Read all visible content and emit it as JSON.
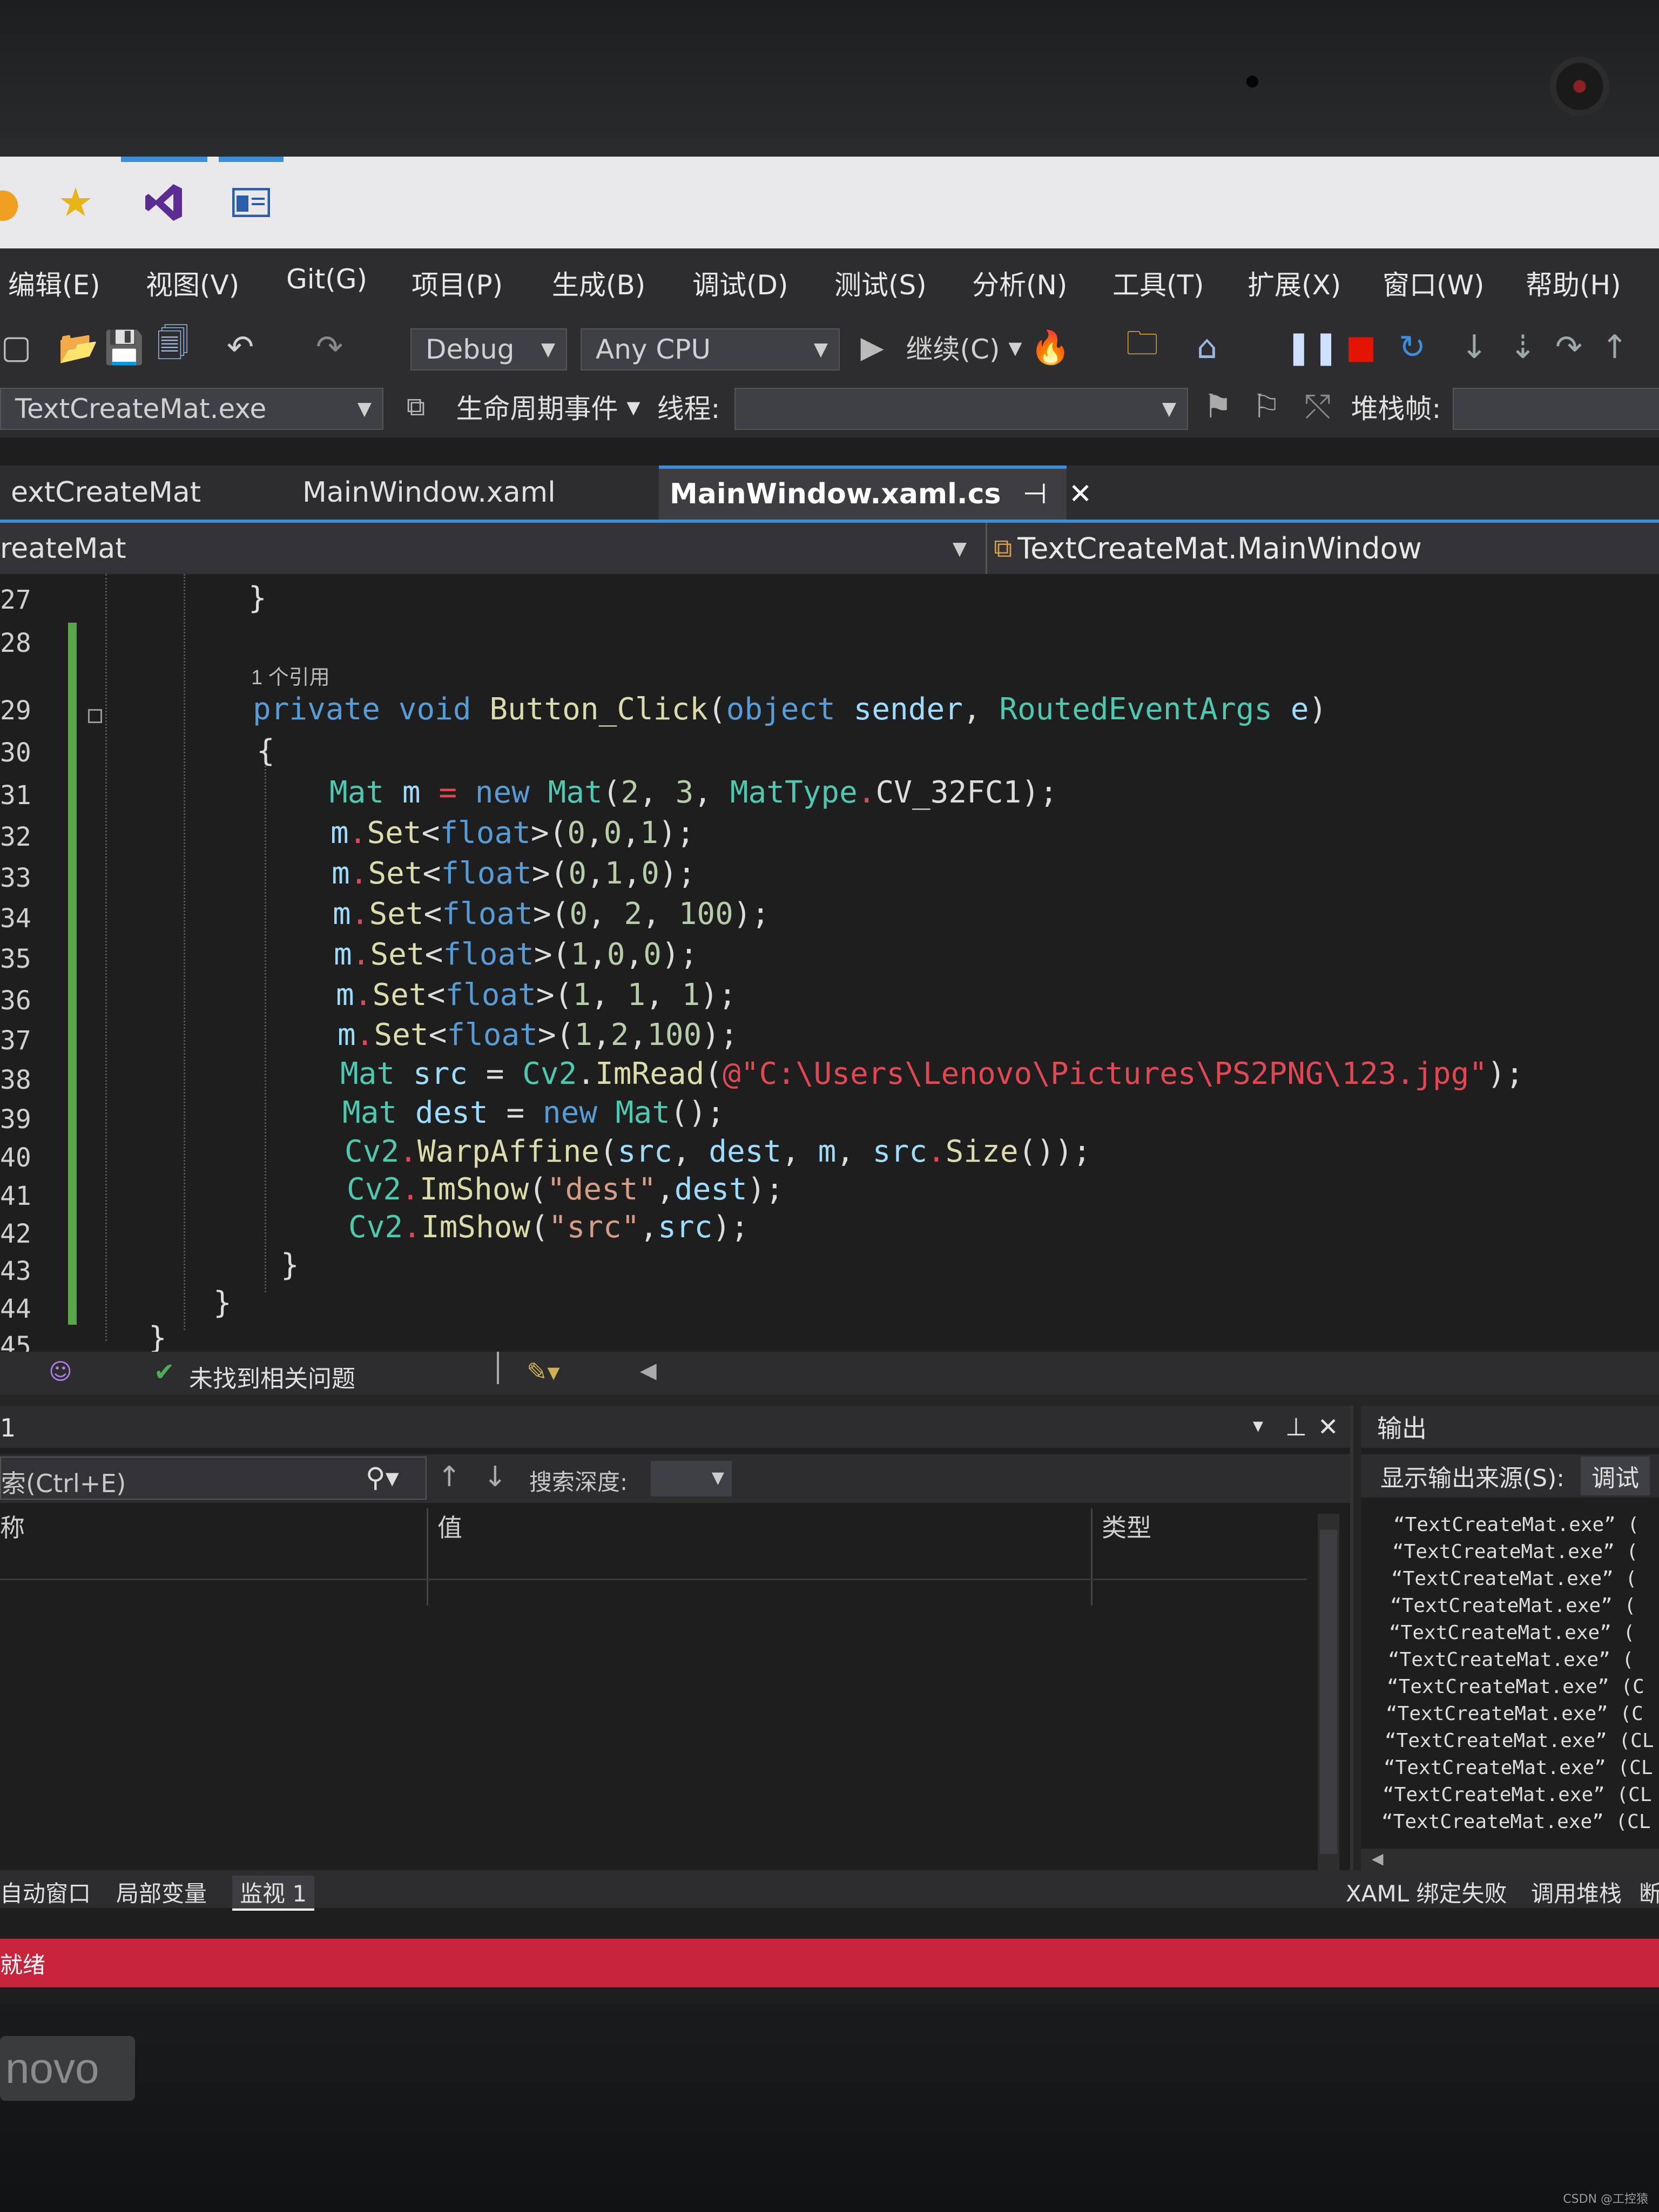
{
  "taskbar": {
    "icons": [
      "star-icon",
      "visual-studio-icon",
      "window-icon"
    ]
  },
  "menu": {
    "items": [
      "编辑(E)",
      "视图(V)",
      "Git(G)",
      "项目(P)",
      "生成(B)",
      "调试(D)",
      "测试(S)",
      "分析(N)",
      "工具(T)",
      "扩展(X)",
      "窗口(W)",
      "帮助(H)"
    ]
  },
  "toolbar": {
    "config": "Debug",
    "platform": "Any CPU",
    "continue": "继续(C)"
  },
  "toolbar2": {
    "process": "TextCreateMat.exe",
    "lifecycle": "生命周期事件",
    "thread": "线程:",
    "stackframe": "堆栈帧:"
  },
  "tabs": [
    "extCreateMat",
    "MainWindow.xaml",
    "MainWindow.xaml.cs"
  ],
  "navbar": {
    "left": "reateMat",
    "right": "TextCreateMat.MainWindow"
  },
  "editor": {
    "line_numbers": [
      "27",
      "28",
      "29",
      "30",
      "31",
      "32",
      "33",
      "34",
      "35",
      "36",
      "37",
      "38",
      "39",
      "40",
      "41",
      "42",
      "43",
      "44",
      "45"
    ],
    "ref_hint": "1 个引用"
  },
  "status": {
    "issues": "未找到相关问题"
  },
  "watch": {
    "title": "1",
    "search": "索(Ctrl+E)",
    "search_depth": "搜索深度:",
    "col_name": "称",
    "col_value": "值",
    "col_type": "类型",
    "tabs": [
      "自动窗口",
      "局部变量",
      "监视 1"
    ]
  },
  "output": {
    "title": "输出",
    "source_label": "显示输出来源(S):",
    "source_value": "调试",
    "lines": [
      "“TextCreateMat.exe” (",
      "“TextCreateMat.exe” (",
      "“TextCreateMat.exe” (",
      "“TextCreateMat.exe” (",
      "“TextCreateMat.exe” (",
      "“TextCreateMat.exe” (",
      "“TextCreateMat.exe” (C",
      "“TextCreateMat.exe” (C",
      "“TextCreateMat.exe” (CL",
      "“TextCreateMat.exe” (CL",
      "“TextCreateMat.exe” (CL",
      "“TextCreateMat.exe” (CL"
    ],
    "tabs": [
      "XAML 绑定失败",
      "调用堆栈",
      "断"
    ]
  },
  "redbar": {
    "text": "就绪"
  },
  "brand": "novo",
  "watermark": "CSDN @工控猿",
  "colors": {
    "accent": "#3c8ed8",
    "status_red": "#c8233c",
    "change_bar": "#57a64a"
  }
}
